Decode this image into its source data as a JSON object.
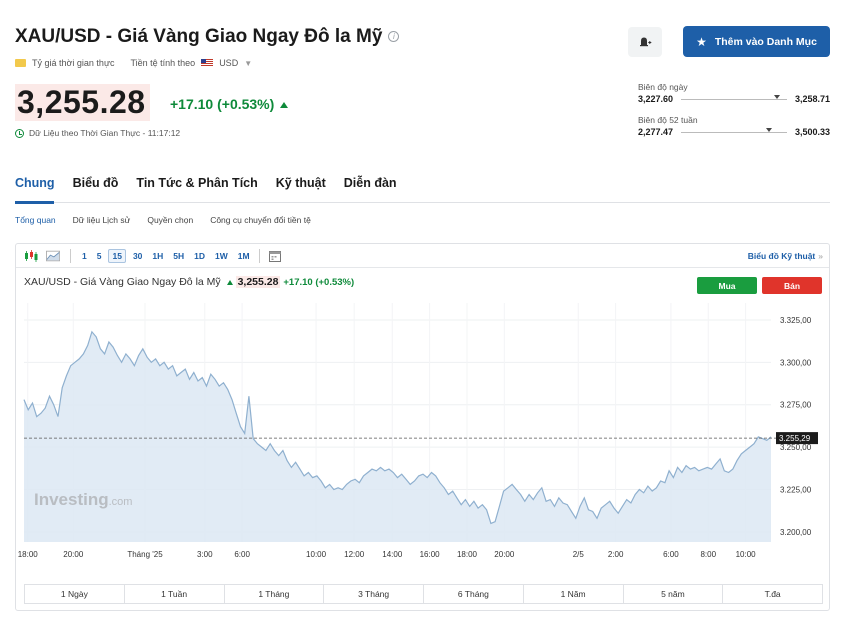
{
  "header": {
    "title": "XAU/USD - Giá Vàng Giao Ngay Đô la Mỹ",
    "realtime_rate_label": "Tỷ giá thời gian thực",
    "currency_label": "Tiền tệ tính theo",
    "currency": "USD",
    "price": "3,255.28",
    "change": "+17.10 (+0.53%)",
    "realtime_note": "Dữ Liệu theo Thời Gian Thực - 11:17:12",
    "watchlist_button": "Thêm vào Danh Mục"
  },
  "ranges": {
    "day_label": "Biên độ ngày",
    "day_low": "3,227.60",
    "day_high": "3,258.71",
    "day_position": 0.88,
    "week52_label": "Biên độ 52 tuần",
    "week52_low": "2,277.47",
    "week52_high": "3,500.33",
    "week52_position": 0.8
  },
  "tabs": [
    "Chung",
    "Biểu đồ",
    "Tin Tức & Phân Tích",
    "Kỹ thuật",
    "Diễn đàn"
  ],
  "subtabs": [
    "Tổng quan",
    "Dữ liệu Lịch sử",
    "Quyền chọn",
    "Công cụ chuyển đổi tiền tệ"
  ],
  "chart_toolbar": {
    "timeframes": [
      "1",
      "5",
      "15",
      "30",
      "1H",
      "5H",
      "1D",
      "1W",
      "1M"
    ],
    "selected": "15",
    "technical_link": "Biểu đồ Kỹ thuật",
    "technical_link_chevron": "»"
  },
  "chart_legend": {
    "name": "XAU/USD - Giá Vàng Giao Ngay Đô la Mỹ",
    "price": "3,255.28",
    "change": "+17.10 (+0.53%)",
    "buy": "Mua",
    "sell": "Bán",
    "watermark_main": "Investing",
    "watermark_suffix": ".com"
  },
  "colors": {
    "accent": "#1e5fa8",
    "up": "#0e8a3a",
    "buy": "#1a9d3f",
    "sell": "#e0342b",
    "area_fill": "#dce8f3",
    "area_line": "#8fb0cf"
  },
  "chart_data": {
    "type": "area",
    "y_ticks": [
      "3.325,00",
      "3.300,00",
      "3.275,00",
      "3.250,00",
      "3.225,00",
      "3.200,00"
    ],
    "y_tick_values": [
      3325,
      3300,
      3275,
      3250,
      3225,
      3200
    ],
    "ylim": [
      3194,
      3335
    ],
    "x_tick_labels": [
      "18:00",
      "20:00",
      "Tháng '25",
      "3:00",
      "6:00",
      "10:00",
      "12:00",
      "14:00",
      "16:00",
      "18:00",
      "20:00",
      "2/5",
      "2:00",
      "6:00",
      "8:00",
      "10:00"
    ],
    "current_value": 3255.29,
    "current_label": "3.255,29",
    "grid": true,
    "values": [
      3278,
      3272,
      3276,
      3268,
      3270,
      3273,
      3280,
      3275,
      3268,
      3285,
      3292,
      3298,
      3300,
      3302,
      3305,
      3310,
      3318,
      3315,
      3308,
      3305,
      3312,
      3309,
      3304,
      3300,
      3305,
      3302,
      3298,
      3304,
      3308,
      3303,
      3300,
      3302,
      3298,
      3300,
      3296,
      3298,
      3292,
      3294,
      3296,
      3290,
      3294,
      3289,
      3291,
      3286,
      3293,
      3290,
      3286,
      3288,
      3284,
      3278,
      3270,
      3262,
      3258,
      3280,
      3255,
      3252,
      3250,
      3248,
      3252,
      3248,
      3245,
      3248,
      3242,
      3238,
      3241,
      3237,
      3233,
      3235,
      3232,
      3233,
      3230,
      3226,
      3228,
      3225,
      3226,
      3225,
      3228,
      3230,
      3231,
      3229,
      3233,
      3235,
      3237,
      3236,
      3238,
      3236,
      3237,
      3235,
      3232,
      3234,
      3231,
      3228,
      3230,
      3233,
      3234,
      3232,
      3235,
      3233,
      3229,
      3226,
      3222,
      3224,
      3220,
      3216,
      3219,
      3215,
      3218,
      3214,
      3216,
      3213,
      3205,
      3206,
      3215,
      3224,
      3226,
      3228,
      3225,
      3222,
      3218,
      3222,
      3219,
      3223,
      3226,
      3218,
      3219,
      3215,
      3220,
      3217,
      3216,
      3212,
      3208,
      3215,
      3220,
      3213,
      3212,
      3208,
      3214,
      3216,
      3218,
      3214,
      3211,
      3215,
      3219,
      3217,
      3222,
      3225,
      3223,
      3227,
      3224,
      3226,
      3230,
      3229,
      3236,
      3232,
      3238,
      3235,
      3239,
      3237,
      3238,
      3236,
      3237,
      3238,
      3237,
      3240,
      3243,
      3236,
      3235,
      3237,
      3242,
      3246,
      3248,
      3250,
      3252,
      3256,
      3255,
      3254,
      3256
    ]
  },
  "periods": [
    "1 Ngày",
    "1 Tuần",
    "1 Tháng",
    "3 Tháng",
    "6 Tháng",
    "1 Năm",
    "5 năm",
    "T.đa"
  ]
}
